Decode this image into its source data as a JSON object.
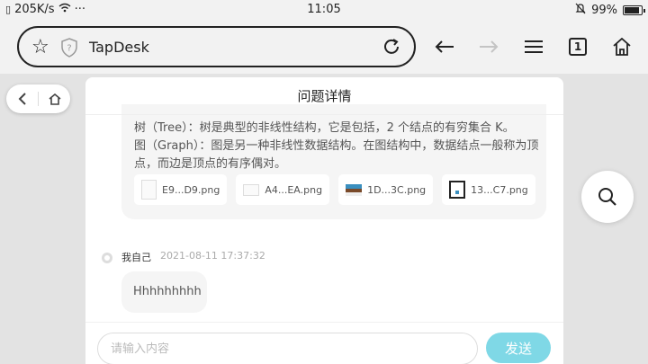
{
  "status_bar": {
    "speed": "205K/s",
    "dots": "···",
    "time": "11:05",
    "battery": "99%"
  },
  "browser": {
    "url_text": "TapDesk",
    "tab_count": "1"
  },
  "panel": {
    "title": "问题详情",
    "message_line1": "树（Tree）：树是典型的非线性结构，它是包括，2 个结点的有穷集合 K。",
    "message_line2": "图（Graph）：图是另一种非线性数据结构。在图结构中，数据结点一般称为顶点，而边是顶点的有序偶对。",
    "attachments": [
      {
        "name": "E9...D9.png",
        "thumb": "portrait"
      },
      {
        "name": "A4...EA.png",
        "thumb": "blank"
      },
      {
        "name": "1D...3C.png",
        "thumb": "banner"
      },
      {
        "name": "13...C7.png",
        "thumb": "framed"
      }
    ],
    "reply": {
      "author": "我自己",
      "timestamp": "2021-08-11 17:37:32",
      "text": "Hhhhhhhhh"
    }
  },
  "input_bar": {
    "placeholder": "请输入内容",
    "send_label": "发送"
  },
  "colors": {
    "send_button": "#7fd8e6",
    "background": "#e3e3e3"
  }
}
